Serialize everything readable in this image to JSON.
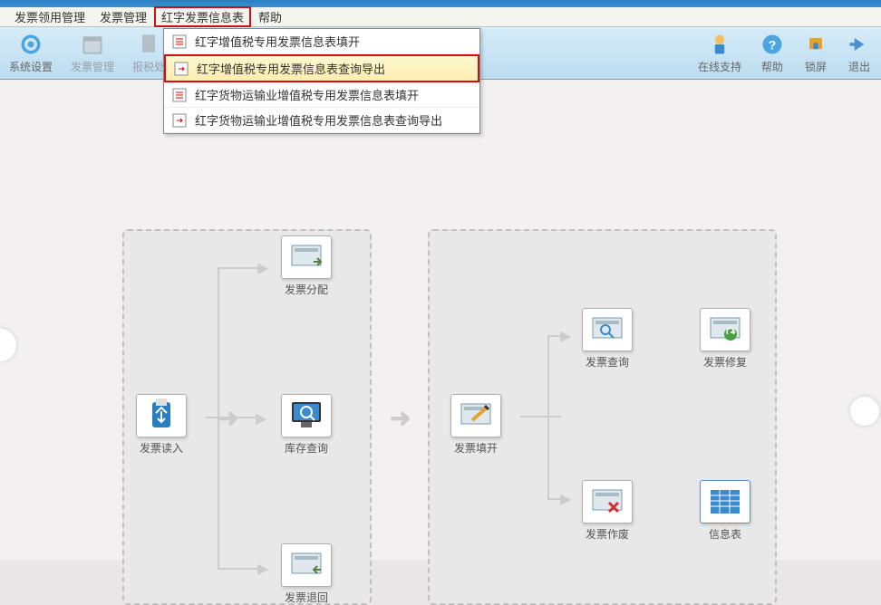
{
  "menubar": {
    "items": [
      {
        "label": "发票领用管理"
      },
      {
        "label": "发票管理"
      },
      {
        "label": "红字发票信息表",
        "highlighted": true
      },
      {
        "label": "帮助"
      }
    ]
  },
  "dropdown": {
    "items": [
      {
        "label": "红字增值税专用发票信息表填开"
      },
      {
        "label": "红字增值税专用发票信息表查询导出",
        "highlighted": true
      },
      {
        "label": "红字货物运输业增值税专用发票信息表填开"
      },
      {
        "label": "红字货物运输业增值税专用发票信息表查询导出"
      }
    ]
  },
  "toolbar": {
    "items": {
      "settings": "系统设置",
      "invoice": "发票管理",
      "tax": "报税处",
      "online": "在线支持",
      "help": "帮助",
      "lock": "锁屏",
      "exit": "退出"
    }
  },
  "nodes": {
    "fpfp": "发票分配",
    "fpdr": "发票读入",
    "kccx": "库存查询",
    "fpth": "发票退回",
    "fptk": "发票填开",
    "fpcx": "发票查询",
    "fpxf": "发票修复",
    "fpzf": "发票作废",
    "xxb": "信息表"
  }
}
